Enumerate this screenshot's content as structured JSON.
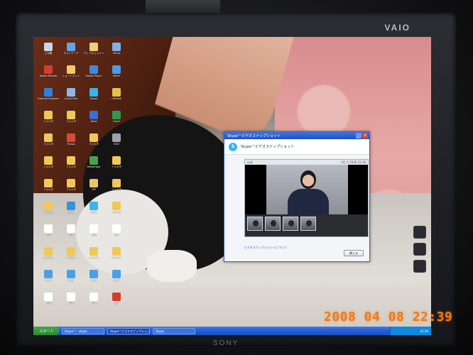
{
  "monitor": {
    "brand_top": "VAIO",
    "brand_bottom": "SONY"
  },
  "skype_window": {
    "title": "Skype™ビデオスナップショット",
    "header": "Skype™ビデオスナップショット",
    "video_user": "yuki",
    "video_info": "4月 5 2008 22:38",
    "link": "ビデオスナップショットについて",
    "close_button": "閉じる"
  },
  "taskbar": {
    "start_label": "スタート",
    "items": [
      "Skype™ - skype",
      "Skype™ビデオスナップショット",
      "Skype"
    ],
    "tray_time": "22:39"
  },
  "photo_stamp": "2008 04 08 22:39",
  "desktop_icons": [
    {
      "label": "ごみ箱",
      "color": "#c9d6e6"
    },
    {
      "label": "ネットワーク",
      "color": "#5ea4e8"
    },
    {
      "label": "マイ ドキュメント",
      "color": "#e9d27a"
    },
    {
      "label": "iTunes",
      "color": "#7fb2ea"
    },
    {
      "label": "Adobe Reader",
      "color": "#d43c2c"
    },
    {
      "label": "ショートカット",
      "color": "#f1c76a"
    },
    {
      "label": "Media Player",
      "color": "#3e8ad8"
    },
    {
      "label": "Safari",
      "color": "#4f9ae0"
    },
    {
      "label": "Internet Explorer",
      "color": "#2f7fe0"
    },
    {
      "label": "QuickTime",
      "color": "#8fb8e8"
    },
    {
      "label": "Skype",
      "color": "#39b5ea"
    },
    {
      "label": "Outlook",
      "color": "#e6c04e"
    },
    {
      "label": "フォルダ",
      "color": "#f0c85a"
    },
    {
      "label": "フォルダ",
      "color": "#f0c85a"
    },
    {
      "label": "Word",
      "color": "#3a6fd6"
    },
    {
      "label": "Excel",
      "color": "#2f9a4a"
    },
    {
      "label": "フォルダ",
      "color": "#f0c85a"
    },
    {
      "label": "Picasa",
      "color": "#d9493b"
    },
    {
      "label": "フォルダ",
      "color": "#f0c85a"
    },
    {
      "label": "DVD",
      "color": "#9f9fa8"
    },
    {
      "label": "フォルダ",
      "color": "#f0c85a"
    },
    {
      "label": "フォルダ",
      "color": "#f0c85a"
    },
    {
      "label": "Messenger",
      "color": "#46a348"
    },
    {
      "label": "フォルダ",
      "color": "#f0c85a"
    },
    {
      "label": "フォルダ",
      "color": "#f0c85a"
    },
    {
      "label": "フォルダ",
      "color": "#f0c85a"
    },
    {
      "label": "ZIP",
      "color": "#e7c96a"
    },
    {
      "label": "フォルダ",
      "color": "#f0c85a"
    },
    {
      "label": "フォルダ",
      "color": "#f0c85a"
    },
    {
      "label": "Media",
      "color": "#3c8fdc"
    },
    {
      "label": "Skype",
      "color": "#39b5ea"
    },
    {
      "label": "フォルダ",
      "color": "#f0c85a"
    },
    {
      "label": "文書",
      "color": "#ffffff"
    },
    {
      "label": "文書",
      "color": "#ffffff"
    },
    {
      "label": "文書",
      "color": "#ffffff"
    },
    {
      "label": "文書",
      "color": "#ffffff"
    },
    {
      "label": "フォルダ",
      "color": "#f0c85a"
    },
    {
      "label": "フォルダ",
      "color": "#f0c85a"
    },
    {
      "label": "フォルダ",
      "color": "#f0c85a"
    },
    {
      "label": "フォルダ",
      "color": "#f0c85a"
    },
    {
      "label": "アプリ",
      "color": "#4aa0e6"
    },
    {
      "label": "アプリ",
      "color": "#4aa0e6"
    },
    {
      "label": "アプリ",
      "color": "#4aa0e6"
    },
    {
      "label": "アプリ",
      "color": "#4aa0e6"
    },
    {
      "label": "文書",
      "color": "#ffffff"
    },
    {
      "label": "文書",
      "color": "#ffffff"
    },
    {
      "label": "文書",
      "color": "#ffffff"
    },
    {
      "label": "PDF",
      "color": "#d43c2c"
    }
  ]
}
